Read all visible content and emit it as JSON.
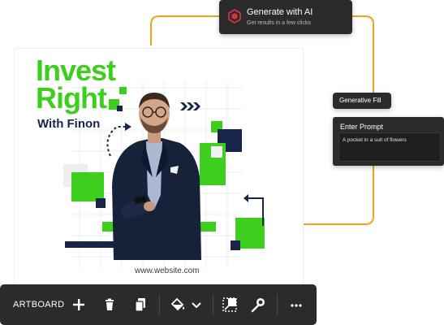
{
  "artboard": {
    "headline_line1": "Invest",
    "headline_line2": "Right",
    "subhead": "With Finon",
    "website": "www.website.com"
  },
  "generate_card": {
    "title": "Generate with AI",
    "subtitle": "Get results in a few clicks"
  },
  "generative_fill": {
    "label": "Generative Fill"
  },
  "prompt_panel": {
    "title": "Enter Prompt",
    "value": "A pocket in a suit of flowers"
  },
  "toolbar": {
    "label": "ARTBOARD",
    "icons": [
      "plus-icon",
      "trash-icon",
      "duplicate-icon",
      "fill-bucket-icon",
      "chevron-down-icon",
      "resize-icon",
      "magic-wand-icon",
      "more-icon"
    ]
  },
  "colors": {
    "accent_green": "#3ecf1e",
    "navy": "#17254a",
    "connector_orange": "#f4a21b",
    "panel_dark": "#2b2b2b",
    "gen_icon_red": "#e0313f"
  }
}
